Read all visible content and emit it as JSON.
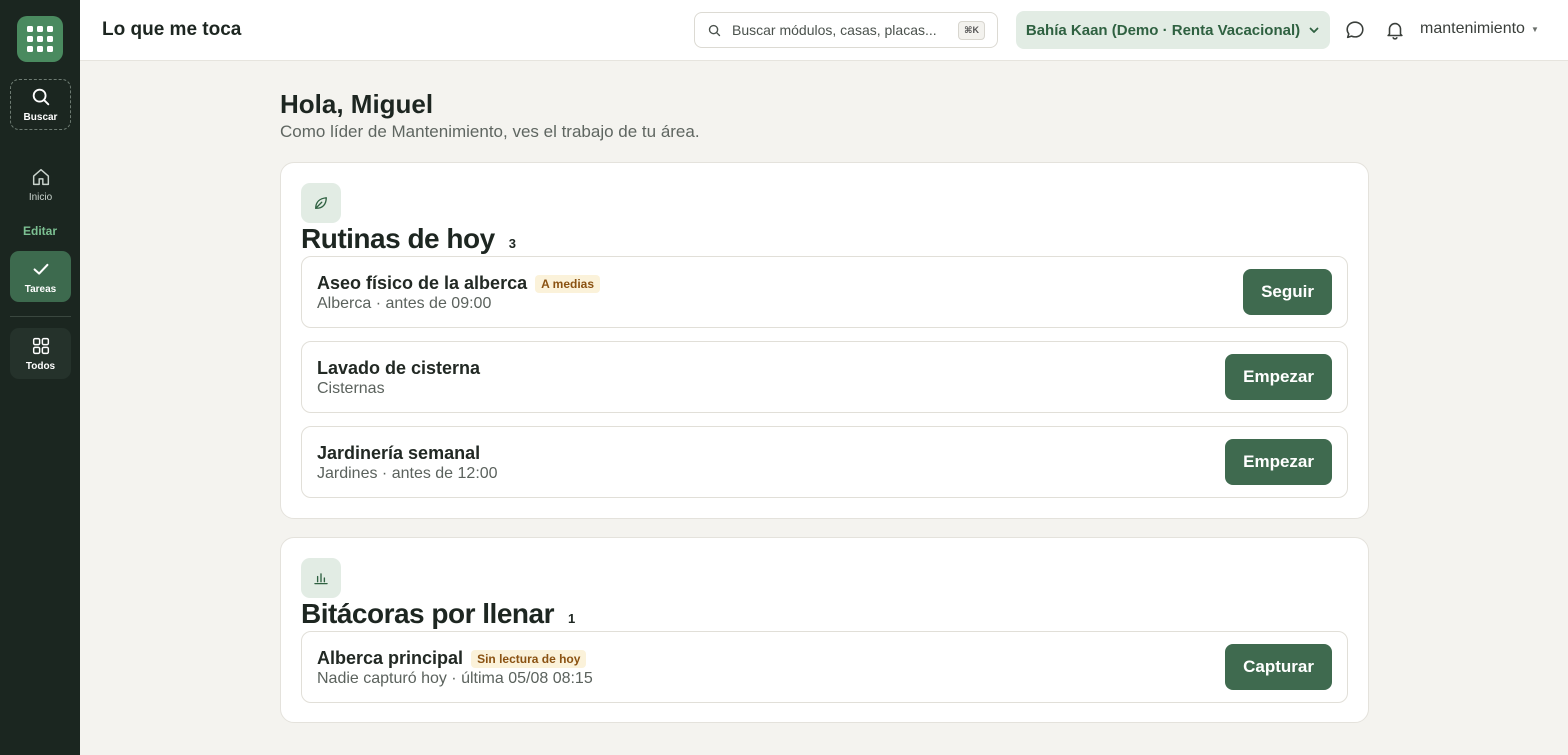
{
  "sidebar": {
    "items": [
      {
        "label": "Buscar",
        "icon": "search-icon"
      },
      {
        "label": "Inicio",
        "icon": "home-icon"
      },
      {
        "label": "Tareas",
        "icon": "check-icon",
        "active": true
      },
      {
        "label": "Todos",
        "icon": "grid-icon"
      }
    ],
    "section_label": "Editar",
    "logo_icon": "apps-grid-icon"
  },
  "header": {
    "title": "Lo que me toca",
    "search_placeholder": "Buscar módulos, casas, placas...",
    "search_shortcut": "⌘K",
    "property": "Bahía Kaan (Demo · Renta Vacacional)",
    "user": "mantenimiento"
  },
  "main": {
    "greeting": "Hola, Miguel",
    "subtitle": "Como líder de Mantenimiento, ves el trabajo de tu área.",
    "sections": [
      {
        "title": "Rutinas de hoy",
        "count": "3",
        "icon": "leaf-icon",
        "rows": [
          {
            "name": "Aseo físico de la alberca",
            "badge": "A medias",
            "meta": "Alberca · antes de 09:00",
            "action": "Seguir"
          },
          {
            "name": "Lavado de cisterna",
            "badge": "",
            "meta": "Cisternas",
            "action": "Empezar"
          },
          {
            "name": "Jardinería semanal",
            "badge": "",
            "meta": "Jardines · antes de 12:00",
            "action": "Empezar"
          }
        ]
      },
      {
        "title": "Bitácoras por llenar",
        "count": "1",
        "icon": "bar-chart-icon",
        "rows": [
          {
            "name": "Alberca principal",
            "badge": "Sin lectura de hoy",
            "meta": "Nadie capturó hoy · última 05/08 08:15",
            "action": "Capturar"
          }
        ]
      }
    ]
  },
  "colors": {
    "sidebar_bg": "#1b2620",
    "accent": "#3f6a4f",
    "accent_light": "#e2ece4",
    "badge_bg": "#fbf2da",
    "badge_text": "#8a5212",
    "page_bg": "#f4f3ef"
  }
}
